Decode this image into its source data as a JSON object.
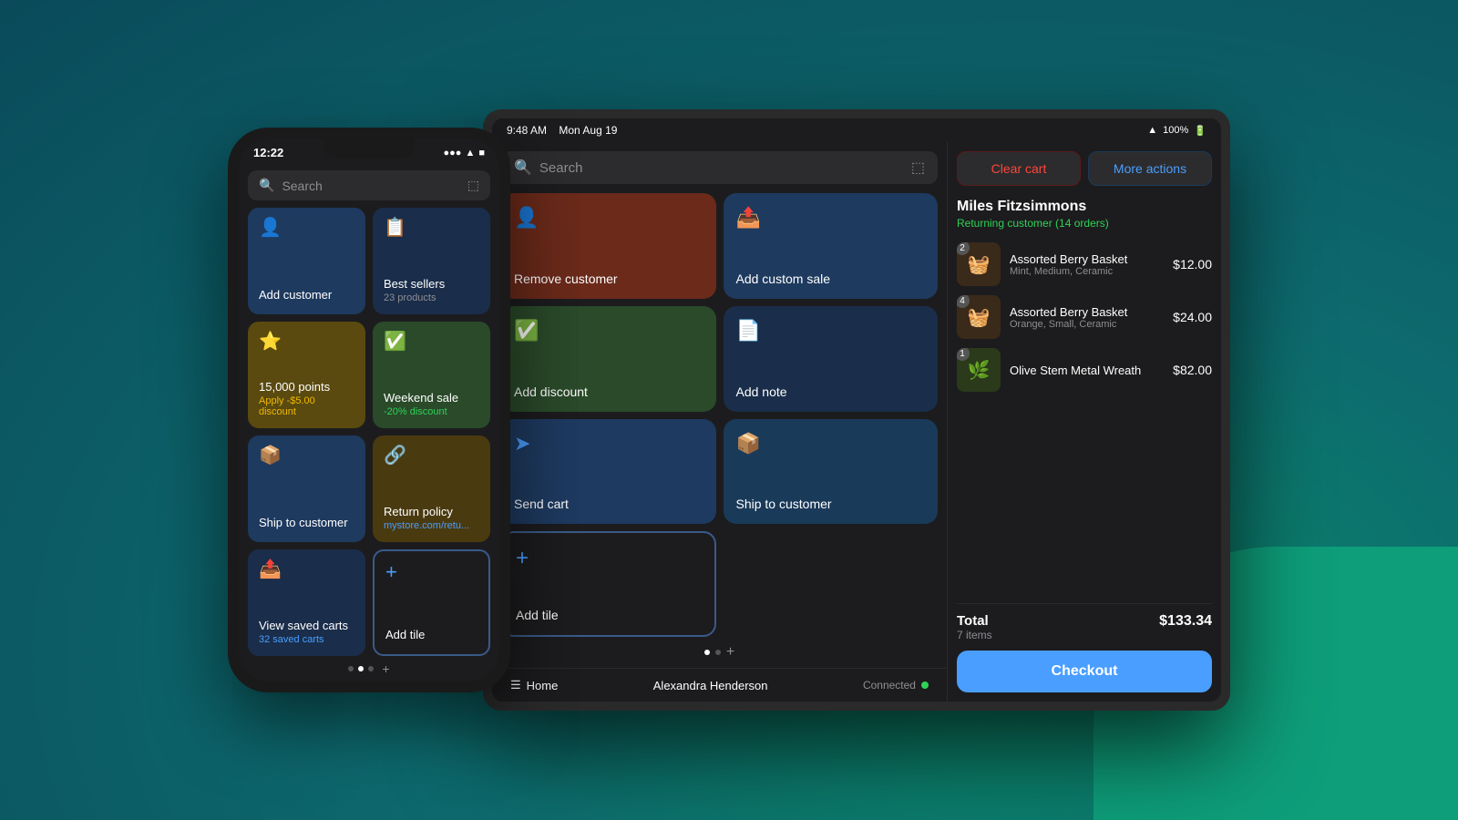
{
  "background": {
    "color": "#0d6b6e"
  },
  "phone": {
    "time": "12:22",
    "status": "●●● ▲ ■",
    "search": {
      "placeholder": "Search",
      "icon": "search"
    },
    "tiles": [
      {
        "id": "add-customer",
        "label": "Add customer",
        "sublabel": "",
        "icon": "👤",
        "color": "blue"
      },
      {
        "id": "best-sellers",
        "label": "Best sellers",
        "sublabel": "23 products",
        "icon": "📋",
        "color": "dark-blue"
      },
      {
        "id": "points",
        "label": "15,000 points",
        "sublabel": "Apply -$5.00 discount",
        "icon": "⭐",
        "color": "gold"
      },
      {
        "id": "weekend-sale",
        "label": "Weekend sale",
        "sublabel": "-20% discount",
        "icon": "✅",
        "color": "green-dark"
      },
      {
        "id": "ship-to-customer",
        "label": "Ship to customer",
        "sublabel": "",
        "icon": "📦",
        "color": "ship"
      },
      {
        "id": "return-policy",
        "label": "Return policy",
        "sublabel": "mystore.com/retu...",
        "icon": "🔗",
        "color": "return"
      },
      {
        "id": "view-saved-carts",
        "label": "View saved carts",
        "sublabel": "32 saved carts",
        "icon": "🔖",
        "color": "saved"
      },
      {
        "id": "add-tile-phone",
        "label": "Add tile",
        "sublabel": "",
        "icon": "+",
        "color": "add-tile-phone"
      }
    ],
    "dots": [
      0,
      1,
      2
    ],
    "active_dot": 1
  },
  "tablet": {
    "status_bar": {
      "time": "9:48 AM",
      "date": "Mon Aug 19",
      "wifi": "▲",
      "battery": "100%"
    },
    "search": {
      "placeholder": "Search",
      "icon": "search",
      "scan_icon": "scan"
    },
    "tiles": [
      {
        "id": "remove-customer",
        "label": "Remove customer",
        "icon": "👤",
        "color": "tt-remove"
      },
      {
        "id": "add-custom-sale",
        "label": "Add custom sale",
        "icon": "📤",
        "color": "tt-custom-sale"
      },
      {
        "id": "add-discount",
        "label": "Add discount",
        "icon": "✅",
        "color": "tt-discount"
      },
      {
        "id": "add-note",
        "label": "Add note",
        "icon": "📄",
        "color": "tt-note"
      },
      {
        "id": "send-cart",
        "label": "Send cart",
        "icon": "➤",
        "color": "tt-send-cart"
      },
      {
        "id": "ship-to-customer",
        "label": "Ship to customer",
        "icon": "📦",
        "color": "tt-ship"
      },
      {
        "id": "add-tile",
        "label": "Add tile",
        "icon": "+",
        "color": "tt-add-tile"
      },
      {
        "id": "empty",
        "label": "",
        "icon": "",
        "color": "tt-empty"
      }
    ],
    "dots": [
      0,
      1
    ],
    "active_dot": 0,
    "bottom_nav": {
      "home_label": "Home",
      "user_label": "Alexandra Henderson",
      "status_label": "Connected"
    },
    "cart": {
      "clear_cart_label": "Clear cart",
      "more_actions_label": "More actions",
      "customer": {
        "name": "Miles Fitzsimmons",
        "status": "Returning customer (14 orders)"
      },
      "items": [
        {
          "id": "item1",
          "name": "Assorted Berry Basket",
          "variant": "Mint, Medium, Ceramic",
          "price": "$12.00",
          "qty": 2,
          "emoji": "🧺"
        },
        {
          "id": "item2",
          "name": "Assorted Berry Basket",
          "variant": "Orange, Small, Ceramic",
          "price": "$24.00",
          "qty": 4,
          "emoji": "🧺"
        },
        {
          "id": "item3",
          "name": "Olive Stem Metal Wreath",
          "variant": "",
          "price": "$82.00",
          "qty": 1,
          "emoji": "🌿"
        }
      ],
      "total_label": "Total",
      "total_items": "7 items",
      "total_amount": "$133.34",
      "checkout_label": "Checkout"
    }
  }
}
